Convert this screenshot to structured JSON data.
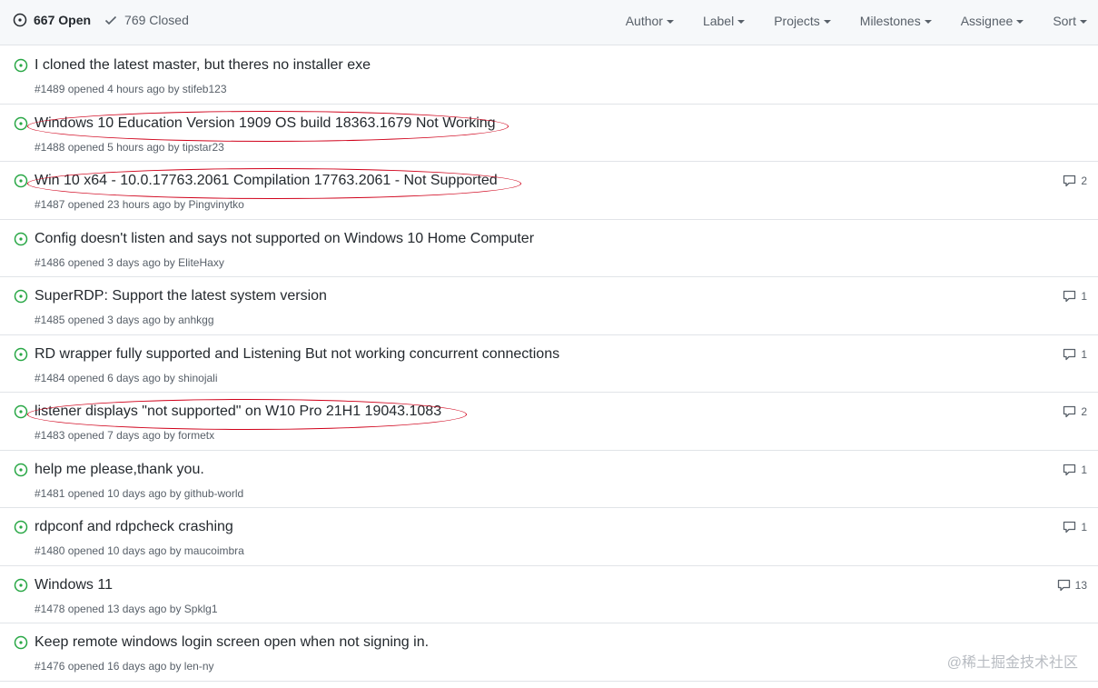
{
  "states": {
    "open_label": "667 Open",
    "closed_label": "769 Closed"
  },
  "filters": [
    "Author",
    "Label",
    "Projects",
    "Milestones",
    "Assignee",
    "Sort"
  ],
  "issues": [
    {
      "title": "I cloned the latest master, but theres no installer exe",
      "meta": "#1489 opened 4 hours ago by stifeb123",
      "comments": "",
      "circled": false
    },
    {
      "title": "Windows 10 Education Version 1909 OS build 18363.1679 Not Working",
      "meta": "#1488 opened 5 hours ago by tipstar23",
      "comments": "",
      "circled": true
    },
    {
      "title": "Win 10 x64 - 10.0.17763.2061 Compilation 17763.2061 - Not Supported",
      "meta": "#1487 opened 23 hours ago by Pingvinytko",
      "comments": "2",
      "circled": true
    },
    {
      "title": "Config doesn't listen and says not supported on Windows 10 Home Computer",
      "meta": "#1486 opened 3 days ago by EliteHaxy",
      "comments": "",
      "circled": false
    },
    {
      "title": "SuperRDP: Support the latest system version",
      "meta": "#1485 opened 3 days ago by anhkgg",
      "comments": "1",
      "circled": false
    },
    {
      "title": "RD wrapper fully supported and Listening But not working concurrent connections",
      "meta": "#1484 opened 6 days ago by shinojali",
      "comments": "1",
      "circled": false
    },
    {
      "title": "listener displays \"not supported\" on W10 Pro 21H1 19043.1083",
      "meta": "#1483 opened 7 days ago by formetx",
      "comments": "2",
      "circled": true
    },
    {
      "title": "help me please,thank you.",
      "meta": "#1481 opened 10 days ago by github-world",
      "comments": "1",
      "circled": false
    },
    {
      "title": "rdpconf and rdpcheck crashing",
      "meta": "#1480 opened 10 days ago by maucoimbra",
      "comments": "1",
      "circled": false
    },
    {
      "title": "Windows 11",
      "meta": "#1478 opened 13 days ago by Spklg1",
      "comments": "13",
      "circled": false
    },
    {
      "title": "Keep remote windows login screen open when not signing in.",
      "meta": "#1476 opened 16 days ago by len-ny",
      "comments": "",
      "circled": false
    }
  ],
  "watermark": "@稀土掘金技术社区",
  "colors": {
    "open_icon": "#28a745",
    "annotation": "#d0021b",
    "header_bg": "#f6f8fa",
    "border": "#e1e4e8"
  }
}
